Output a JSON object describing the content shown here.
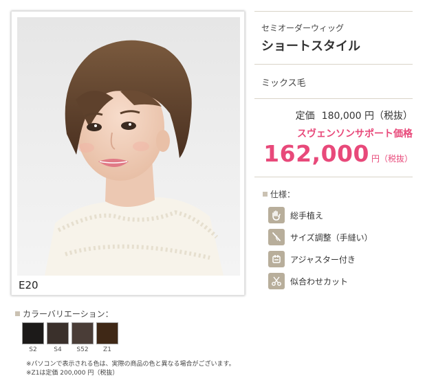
{
  "photo": {
    "model_code": "E20"
  },
  "product": {
    "subtitle": "セミオーダーウィッグ",
    "title": "ショートスタイル",
    "material": "ミックス毛"
  },
  "pricing": {
    "list_label": "定価",
    "list_amount": "180,000 円（税抜）",
    "sale_label": "スヴェンソンサポート価格",
    "sale_amount": "162,000",
    "sale_unit": "円（税抜）",
    "accent_color": "#e8497a"
  },
  "specs": {
    "heading": "仕様：",
    "items": [
      {
        "label": "総手植え",
        "icon": "hand-icon"
      },
      {
        "label": "サイズ調整（手縫い）",
        "icon": "needle-icon"
      },
      {
        "label": "アジャスター付き",
        "icon": "adjuster-icon"
      },
      {
        "label": "似合わせカット",
        "icon": "scissors-icon"
      }
    ]
  },
  "colors": {
    "heading": "カラーバリエーション：",
    "swatches": [
      {
        "label": "S2",
        "color": "#1c1a19"
      },
      {
        "label": "S4",
        "color": "#3a302b"
      },
      {
        "label": "S52",
        "color": "#4a3d37"
      },
      {
        "label": "Z1",
        "color": "#3f2816"
      }
    ]
  },
  "notes": [
    "※パソコンで表示される色は、実際の商品の色と異なる場合がございます。",
    "※Z1は定価 200,000 円（税抜）"
  ]
}
